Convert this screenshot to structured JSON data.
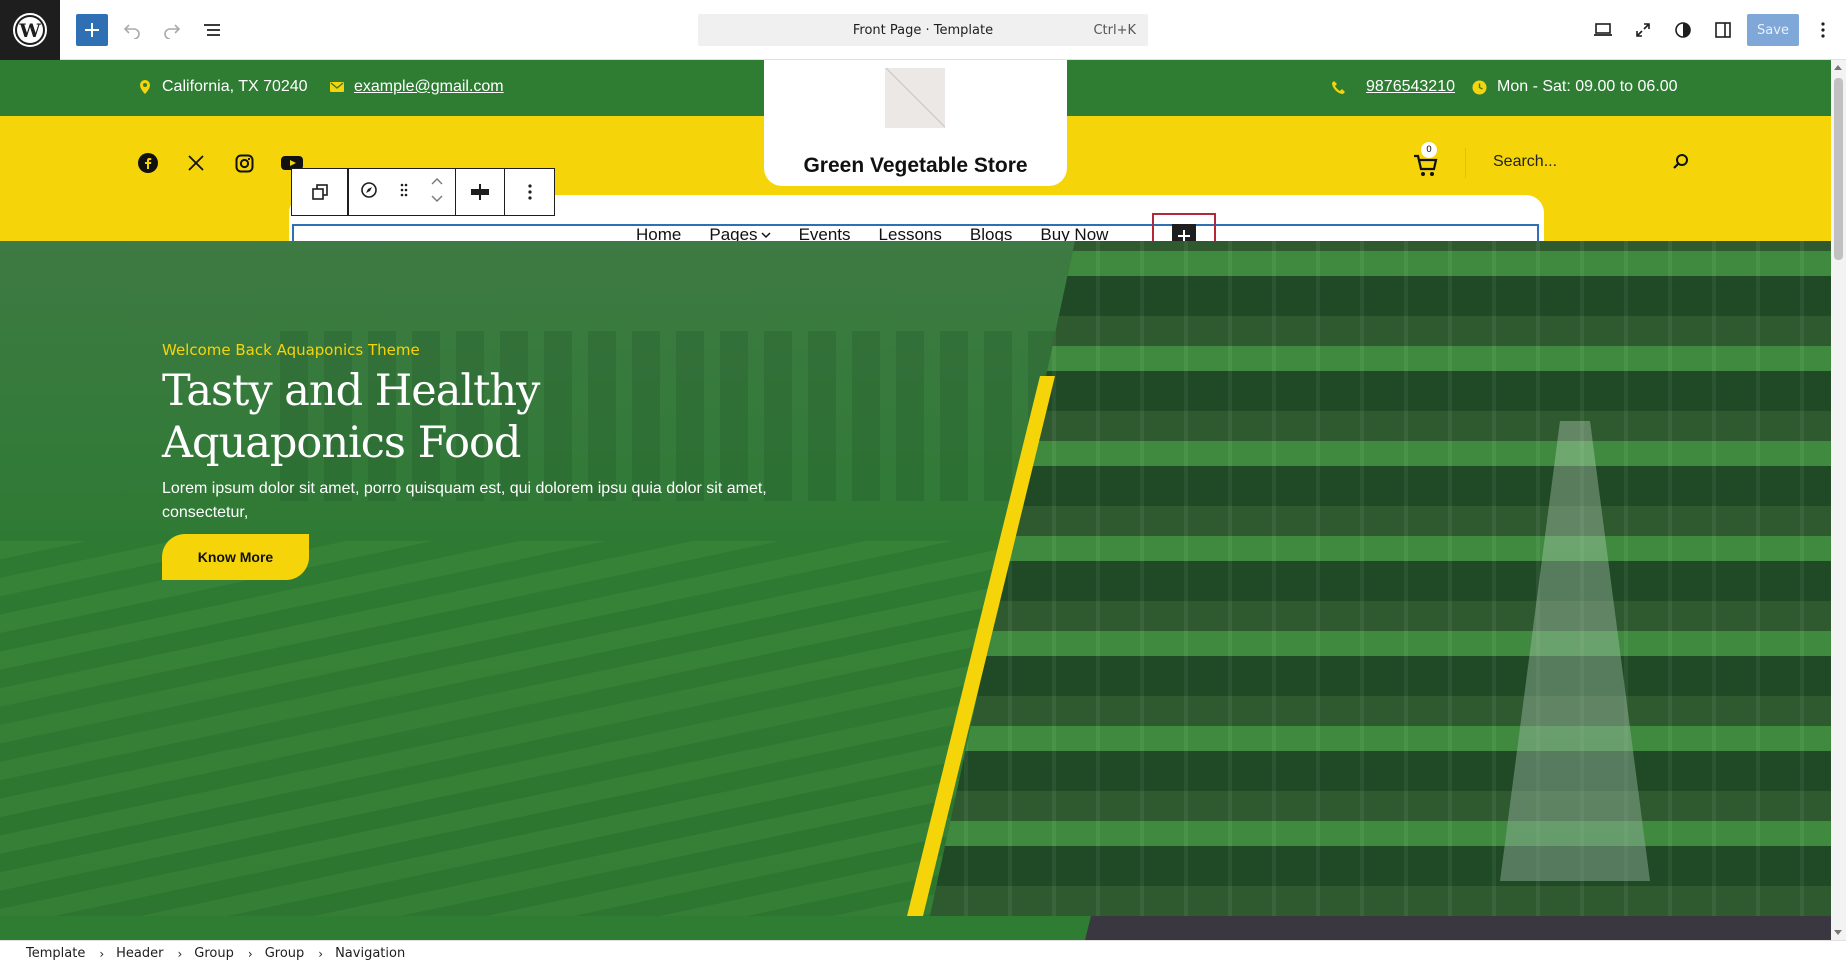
{
  "editor": {
    "document_title": "Front Page · Template",
    "shortcut": "Ctrl+K",
    "save_label": "Save"
  },
  "header": {
    "location": "California, TX 70240",
    "email": "example@gmail.com",
    "phone": "9876543210",
    "hours": "Mon - Sat: 09.00 to 06.00",
    "site_title": "Green Vegetable Store",
    "cart_count": "0",
    "search_placeholder": "Search...",
    "social": [
      "facebook-icon",
      "x-icon",
      "instagram-icon",
      "youtube-icon"
    ]
  },
  "navigation": {
    "items": [
      {
        "label": "Home"
      },
      {
        "label": "Pages",
        "has_submenu": true
      },
      {
        "label": "Events"
      },
      {
        "label": "Lessons"
      },
      {
        "label": "Blogs"
      },
      {
        "label": "Buy Now"
      }
    ]
  },
  "hero": {
    "eyebrow": "Welcome Back Aquaponics Theme",
    "title_line1": "Tasty and Healthy",
    "title_line2": "Aquaponics Food",
    "description": "Lorem ipsum dolor sit amet, porro quisquam est, qui dolorem ipsu quia dolor sit amet, consectetur,",
    "button_label": "Know More"
  },
  "breadcrumbs": [
    "Template",
    "Header",
    "Group",
    "Group",
    "Navigation"
  ],
  "colors": {
    "brand_green": "#2e7d32",
    "brand_yellow": "#f5d50a",
    "editor_accent": "#2f6fb3",
    "selection_outline": "#b0283a"
  }
}
